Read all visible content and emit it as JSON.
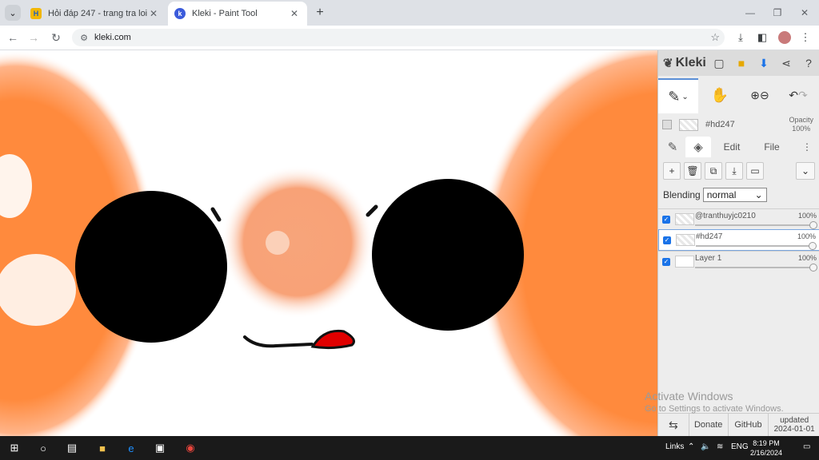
{
  "browser": {
    "tabs": [
      {
        "title": "Hỏi đáp 247 - trang tra loi",
        "active": false
      },
      {
        "title": "Kleki - Paint Tool",
        "active": true
      }
    ],
    "url": "kleki.com",
    "window_controls": {
      "minimize": "—",
      "restore": "❐",
      "close": "✕"
    }
  },
  "kleki": {
    "logo": "Kleki",
    "layer_preview": {
      "name": "#hd247",
      "opacity_label": "Opacity",
      "opacity_value": "100%"
    },
    "panel_tabs": {
      "edit": "Edit",
      "file": "File"
    },
    "blending_label": "Blending",
    "blending_value": "normal",
    "layers": [
      {
        "name": "@tranthuyjc0210",
        "opacity": "100%",
        "selected": false
      },
      {
        "name": "#hd247",
        "opacity": "100%",
        "selected": true
      },
      {
        "name": "Layer 1",
        "opacity": "100%",
        "selected": false
      }
    ],
    "footer": {
      "donate": "Donate",
      "github": "GitHub",
      "updated_label": "updated",
      "updated_date": "2024-01-01"
    }
  },
  "watermark": {
    "title": "Activate Windows",
    "subtitle": "Go to Settings to activate Windows."
  },
  "taskbar": {
    "links": "Links",
    "lang": "ENG",
    "time": "8:19 PM",
    "date": "2/16/2024"
  },
  "colors": {
    "orange": "#ff8a3d",
    "black": "#000000",
    "red": "#e00000",
    "accent": "#1a73e8"
  }
}
